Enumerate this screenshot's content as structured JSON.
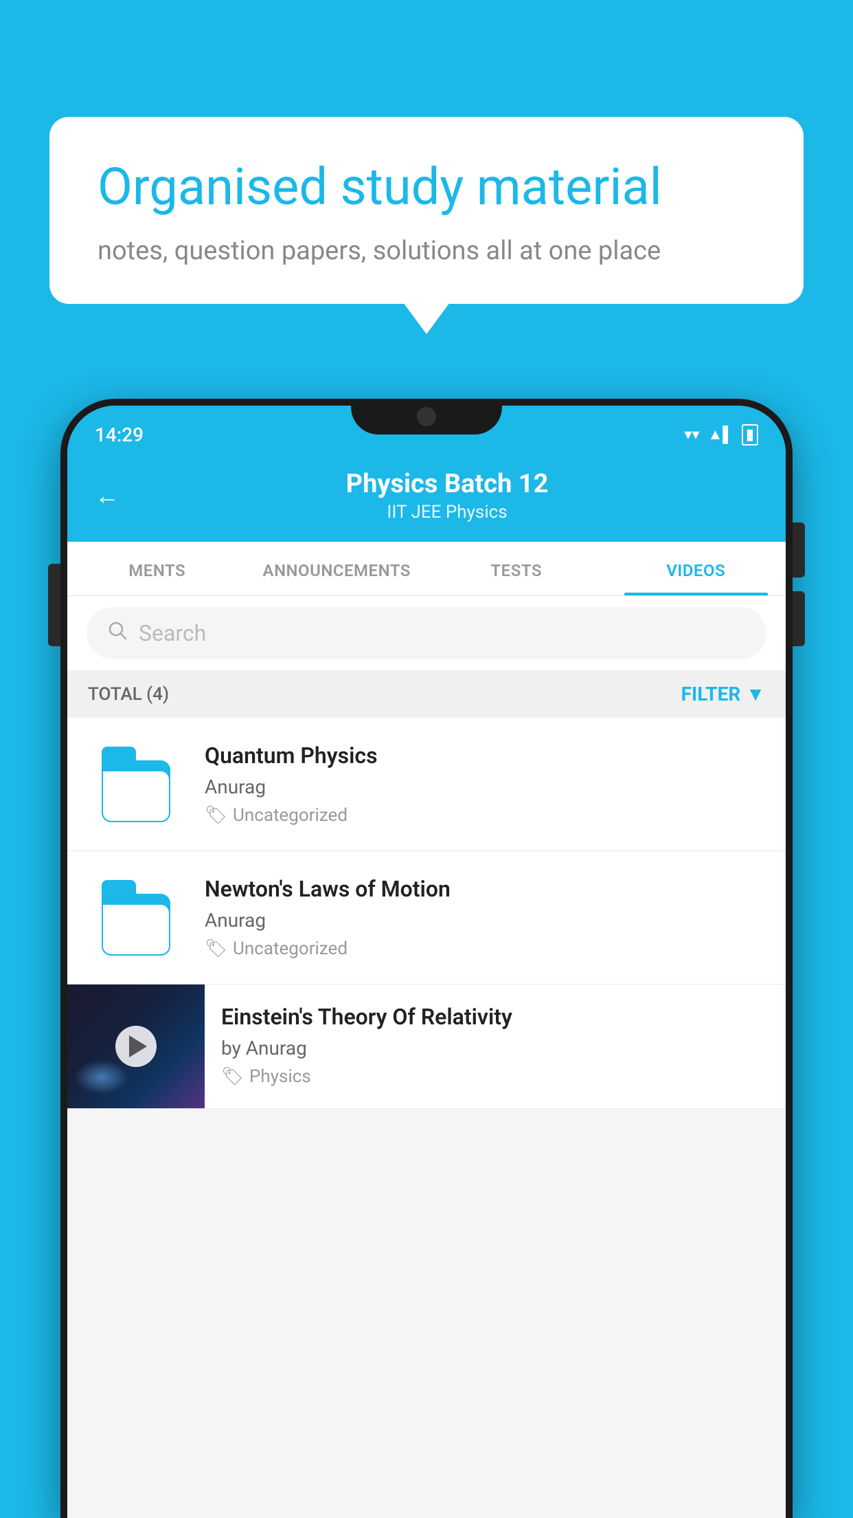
{
  "background_color": "#1bb8e8",
  "bubble": {
    "title": "Organised study material",
    "subtitle": "notes, question papers, solutions all at one place"
  },
  "status_bar": {
    "time": "14:29",
    "wifi": "▼",
    "signal": "▲",
    "battery": "▮"
  },
  "header": {
    "title": "Physics Batch 12",
    "subtitle": "IIT JEE   Physics",
    "back_label": "←"
  },
  "tabs": [
    {
      "label": "MENTS",
      "active": false
    },
    {
      "label": "ANNOUNCEMENTS",
      "active": false
    },
    {
      "label": "TESTS",
      "active": false
    },
    {
      "label": "VIDEOS",
      "active": true
    }
  ],
  "search": {
    "placeholder": "Search"
  },
  "filter": {
    "total_label": "TOTAL (4)",
    "button_label": "FILTER"
  },
  "videos": [
    {
      "id": 1,
      "title": "Quantum Physics",
      "author": "Anurag",
      "tag": "Uncategorized",
      "has_thumbnail": false
    },
    {
      "id": 2,
      "title": "Newton's Laws of Motion",
      "author": "Anurag",
      "tag": "Uncategorized",
      "has_thumbnail": false
    },
    {
      "id": 3,
      "title": "Einstein's Theory Of Relativity",
      "author": "by Anurag",
      "tag": "Physics",
      "has_thumbnail": true
    }
  ]
}
